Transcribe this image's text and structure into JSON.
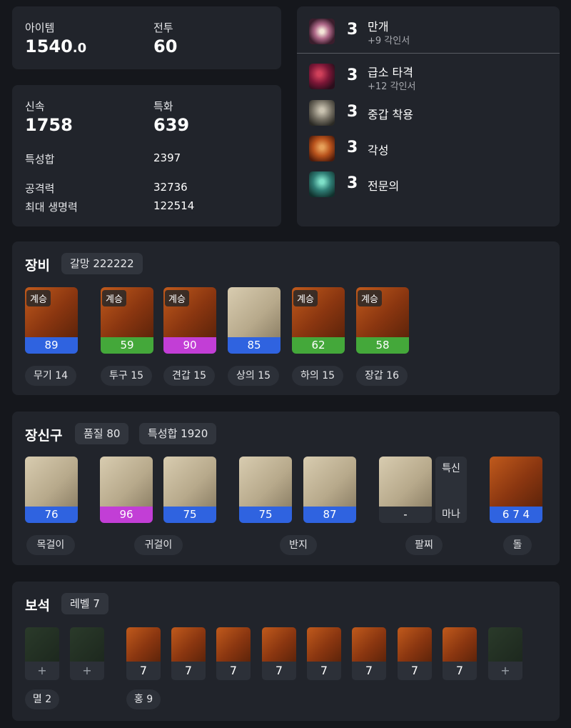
{
  "summary": {
    "item_label": "아이템",
    "item_value": "1540",
    "item_decimal": ".0",
    "combat_label": "전투",
    "combat_value": "60"
  },
  "stats": {
    "swift_label": "신속",
    "swift_value": "1758",
    "spec_label": "특화",
    "spec_value": "639",
    "total_label": "특성합",
    "total_value": "2397",
    "atk_label": "공격력",
    "atk_value": "32736",
    "hp_label": "최대 생명력",
    "hp_value": "122514"
  },
  "engravings": [
    {
      "level": "3",
      "name": "만개",
      "sub": "+9 각인서",
      "icon": "burst-icon"
    },
    {
      "level": "3",
      "name": "급소 타격",
      "sub": "+12 각인서",
      "icon": "strike-icon"
    },
    {
      "level": "3",
      "name": "중갑 착용",
      "sub": "",
      "icon": "armor-icon"
    },
    {
      "level": "3",
      "name": "각성",
      "sub": "",
      "icon": "awaken-icon"
    },
    {
      "level": "3",
      "name": "전문의",
      "sub": "",
      "icon": "medic-icon"
    }
  ],
  "equipment": {
    "title": "장비",
    "badge": "갈망 222222",
    "items": [
      {
        "tag": "계승",
        "quality": "89",
        "color": "#2f63e0",
        "label": "무기 14",
        "icon": "weapon-icon"
      },
      {
        "tag": "계승",
        "quality": "59",
        "color": "#44a83a",
        "label": "투구 15",
        "icon": "helmet-icon"
      },
      {
        "tag": "계승",
        "quality": "90",
        "color": "#c23ed6",
        "label": "견갑 15",
        "icon": "shoulder-icon"
      },
      {
        "tag": "",
        "quality": "85",
        "color": "#2f63e0",
        "label": "상의 15",
        "icon": "chest-icon"
      },
      {
        "tag": "계승",
        "quality": "62",
        "color": "#44a83a",
        "label": "하의 15",
        "icon": "pants-icon"
      },
      {
        "tag": "계승",
        "quality": "58",
        "color": "#44a83a",
        "label": "장갑 16",
        "icon": "gloves-icon"
      }
    ]
  },
  "accessories": {
    "title": "장신구",
    "quality_badge": "품질 80",
    "stat_badge": "특성합 1920",
    "items": [
      {
        "quality": "76",
        "color": "#2f63e0",
        "icon": "necklace-icon"
      },
      {
        "quality": "96",
        "color": "#c23ed6",
        "icon": "earring-icon"
      },
      {
        "quality": "75",
        "color": "#2f63e0",
        "icon": "earring-icon"
      },
      {
        "quality": "75",
        "color": "#2f63e0",
        "icon": "ring-icon"
      },
      {
        "quality": "87",
        "color": "#2f63e0",
        "icon": "ring-icon"
      }
    ],
    "bracelet": {
      "quality": "-",
      "stat1": "특신",
      "stat2": "마나"
    },
    "stone": {
      "value": "6 7 4"
    },
    "labels": [
      "목걸이",
      "귀걸이",
      "반지",
      "팔찌",
      "돌"
    ]
  },
  "gems": {
    "title": "보석",
    "badge": "레벨 7",
    "items": [
      "+",
      "+",
      "7",
      "7",
      "7",
      "7",
      "7",
      "7",
      "7",
      "7",
      "+"
    ],
    "labels": [
      "멸 2",
      "홍 9"
    ]
  }
}
